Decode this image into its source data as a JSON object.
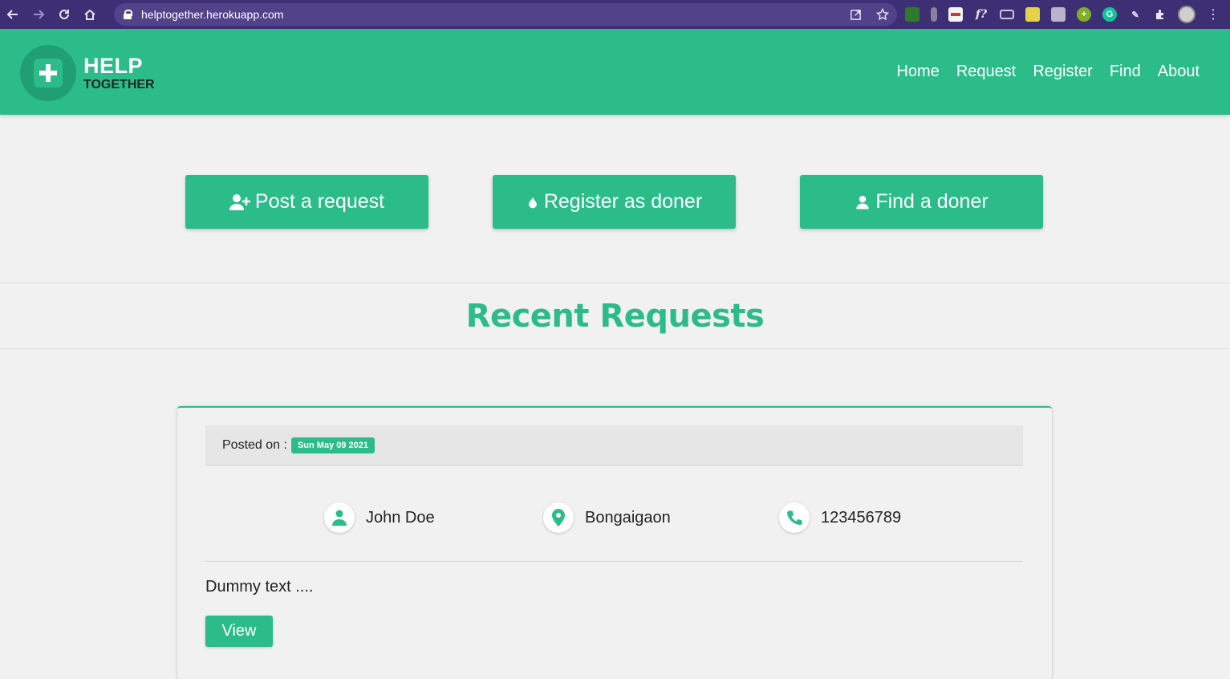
{
  "browser": {
    "url": "helptogether.herokuapp.com"
  },
  "header": {
    "logo_line1": "HELP",
    "logo_line2": "TOGETHER",
    "nav": [
      "Home",
      "Request",
      "Register",
      "Find",
      "About"
    ]
  },
  "actions": {
    "post_request": "Post a request",
    "register_doner": "Register as doner",
    "find_doner": "Find a doner"
  },
  "section": {
    "title": "Recent Requests"
  },
  "request_card": {
    "posted_label": "Posted on :",
    "date": "Sun May 09 2021",
    "name": "John Doe",
    "location": "Bongaigaon",
    "phone": "123456789",
    "description": "Dummy text ....",
    "view_label": "View"
  },
  "colors": {
    "brand": "#2bbc8a",
    "browser_bar": "#3d2f73"
  },
  "icons": [
    "back-icon",
    "forward-icon",
    "reload-icon",
    "home-icon",
    "lock-icon",
    "share-icon",
    "star-icon",
    "extensions-icon",
    "user-plus-icon",
    "droplet-icon",
    "user-icon",
    "location-pin-icon",
    "phone-icon"
  ]
}
